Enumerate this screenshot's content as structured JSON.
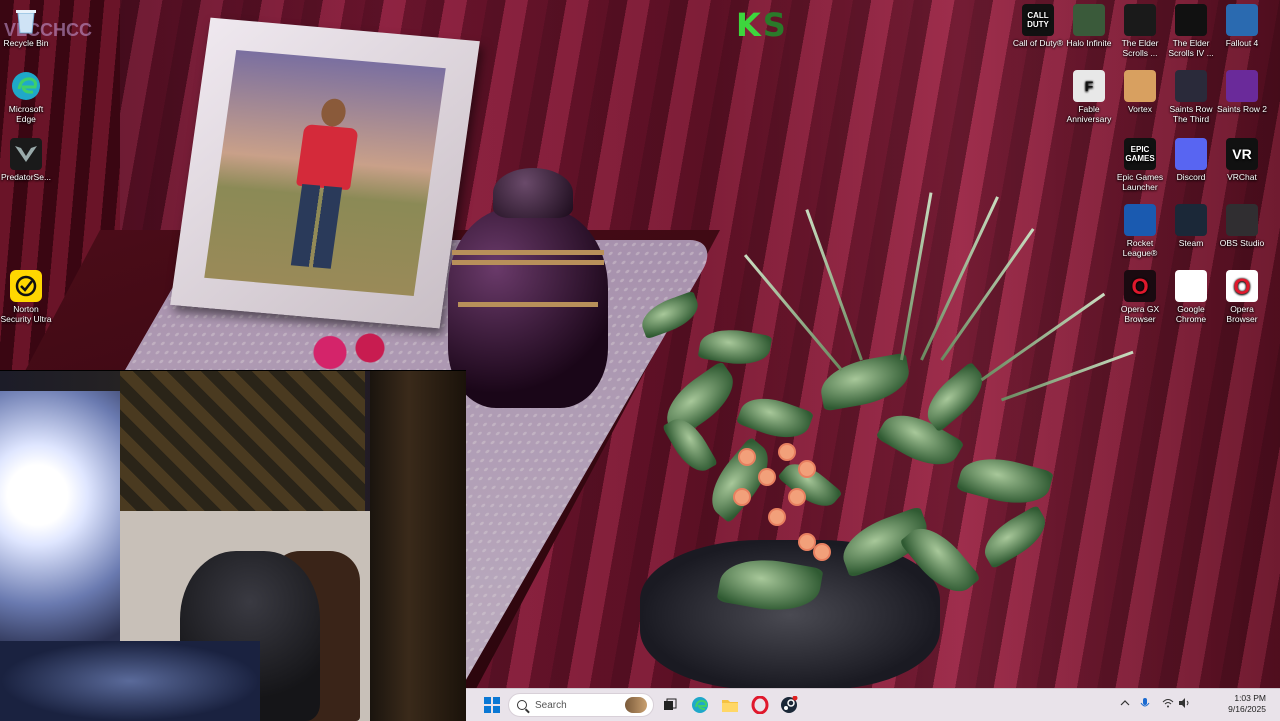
{
  "watermark": {
    "k": "K",
    "s": "S"
  },
  "overlay": "VLCCHCC",
  "desktop_left": [
    {
      "name": "recycle-bin-icon",
      "label": "Recycle Bin",
      "color": "#7ab0d8"
    },
    {
      "name": "microsoft-edge-icon",
      "label": "Microsoft Edge",
      "color": "#1fa8c9"
    },
    {
      "name": "predatorsense-icon",
      "label": "PredatorSe...",
      "color": "#2a2a2a"
    },
    {
      "name": "norton-security-icon",
      "label": "Norton Security Ultra",
      "color": "#ffd700"
    }
  ],
  "desktop_right": [
    {
      "name": "call-of-duty-icon",
      "label": "Call of Duty®",
      "glyph": "CALL DUTY",
      "color": "#111111"
    },
    {
      "name": "halo-infinite-icon",
      "label": "Halo Infinite",
      "glyph": "",
      "color": "#3a5a3a"
    },
    {
      "name": "elder-scrolls-skyrim-icon",
      "label": "The Elder Scrolls ...",
      "glyph": "",
      "color": "#1a1a1a"
    },
    {
      "name": "elder-scrolls-oblivion-icon",
      "label": "The Elder Scrolls IV ...",
      "glyph": "",
      "color": "#111111"
    },
    {
      "name": "fallout-4-icon",
      "label": "Fallout 4",
      "glyph": "",
      "color": "#2a6ab0"
    },
    {
      "name": "fable-anniversary-icon",
      "label": "Fable Anniversary",
      "glyph": "F",
      "color": "#e8e8e8"
    },
    {
      "name": "vortex-icon",
      "label": "Vortex",
      "glyph": "",
      "color": "#d8a060"
    },
    {
      "name": "saints-row-third-icon",
      "label": "Saints Row The Third",
      "glyph": "",
      "color": "#2a2a3a"
    },
    {
      "name": "saints-row-2-icon",
      "label": "Saints Row 2",
      "glyph": "",
      "color": "#6a2a9a"
    },
    {
      "name": "epic-games-launcher-icon",
      "label": "Epic Games Launcher",
      "glyph": "EPIC GAMES",
      "color": "#111111"
    },
    {
      "name": "discord-icon",
      "label": "Discord",
      "glyph": "",
      "color": "#5865f2"
    },
    {
      "name": "vrchat-icon",
      "label": "VRChat",
      "glyph": "VR",
      "color": "#111111"
    },
    {
      "name": "rocket-league-icon",
      "label": "Rocket League®",
      "glyph": "",
      "color": "#1a5ab0"
    },
    {
      "name": "steam-icon",
      "label": "Steam",
      "glyph": "",
      "color": "#1b2838"
    },
    {
      "name": "obs-studio-icon",
      "label": "OBS Studio",
      "glyph": "",
      "color": "#302e31"
    },
    {
      "name": "opera-gx-icon",
      "label": "Opera GX Browser",
      "glyph": "O",
      "color": "#1a0a10"
    },
    {
      "name": "google-chrome-icon",
      "label": "Google Chrome",
      "glyph": "",
      "color": "#ffffff"
    },
    {
      "name": "opera-browser-icon",
      "label": "Opera Browser",
      "glyph": "O",
      "color": "#ffffff"
    }
  ],
  "taskbar": {
    "search_placeholder": "Search",
    "apps": [
      "task-view-icon",
      "edge-icon",
      "file-explorer-icon",
      "opera-icon",
      "steam-icon"
    ]
  },
  "clock": {
    "time": "1:03 PM",
    "date": "9/16/2025"
  },
  "colors": {
    "accent": "#0a78d4",
    "taskbar_bg": "#e9e3ea"
  }
}
